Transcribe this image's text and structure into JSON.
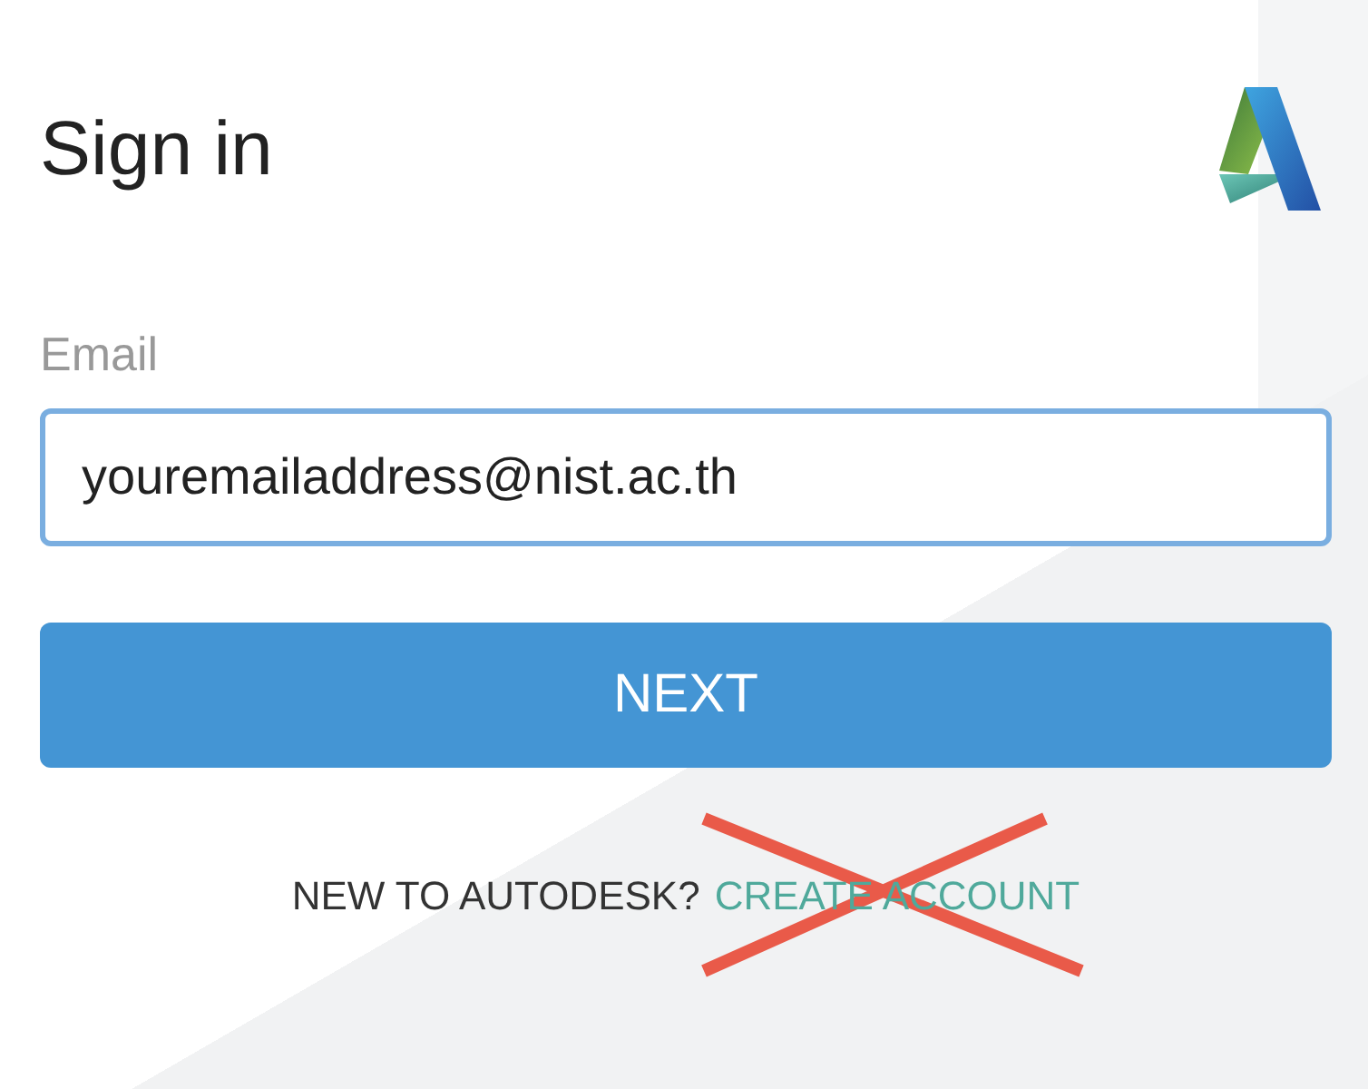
{
  "title": "Sign in",
  "email": {
    "label": "Email",
    "value": "youremailaddress@nist.ac.th"
  },
  "next_button": "NEXT",
  "footer": {
    "prompt": "NEW TO AUTODESK?",
    "link": "CREATE ACCOUNT",
    "crossed_out": true
  }
}
